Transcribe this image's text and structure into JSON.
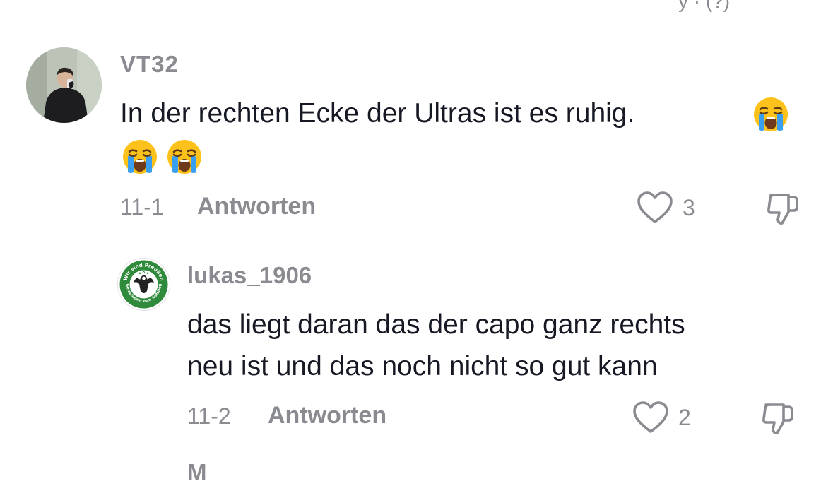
{
  "comments": [
    {
      "username": "VT32",
      "text": "In der rechten Ecke der Ultras ist es ruhig.",
      "emojis": [
        "loudly-crying-face",
        "loudly-crying-face",
        "loudly-crying-face"
      ],
      "date": "11-1",
      "reply_label": "Antworten",
      "likes": "3",
      "avatar_icon": "user-photo-avatar"
    }
  ],
  "replies": [
    {
      "username": "lukas_1906",
      "text_line1": "das liegt daran das der capo ganz rechts",
      "text_line2": "neu ist und das noch nicht so gut kann",
      "date": "11-2",
      "reply_label": "Antworten",
      "likes": "2",
      "avatar_icon": "club-emblem-avatar",
      "avatar_logo_text": "Wir sind Preußen · Gemeinsam zum Aufstieg"
    }
  ],
  "colors": {
    "text": "#161823",
    "muted": "#8a8b91",
    "emblem_green": "#2f8a3c",
    "background": "#ffffff"
  },
  "icons": {
    "like": "heart-outline-icon",
    "dislike": "thumbs-down-outline-icon"
  }
}
